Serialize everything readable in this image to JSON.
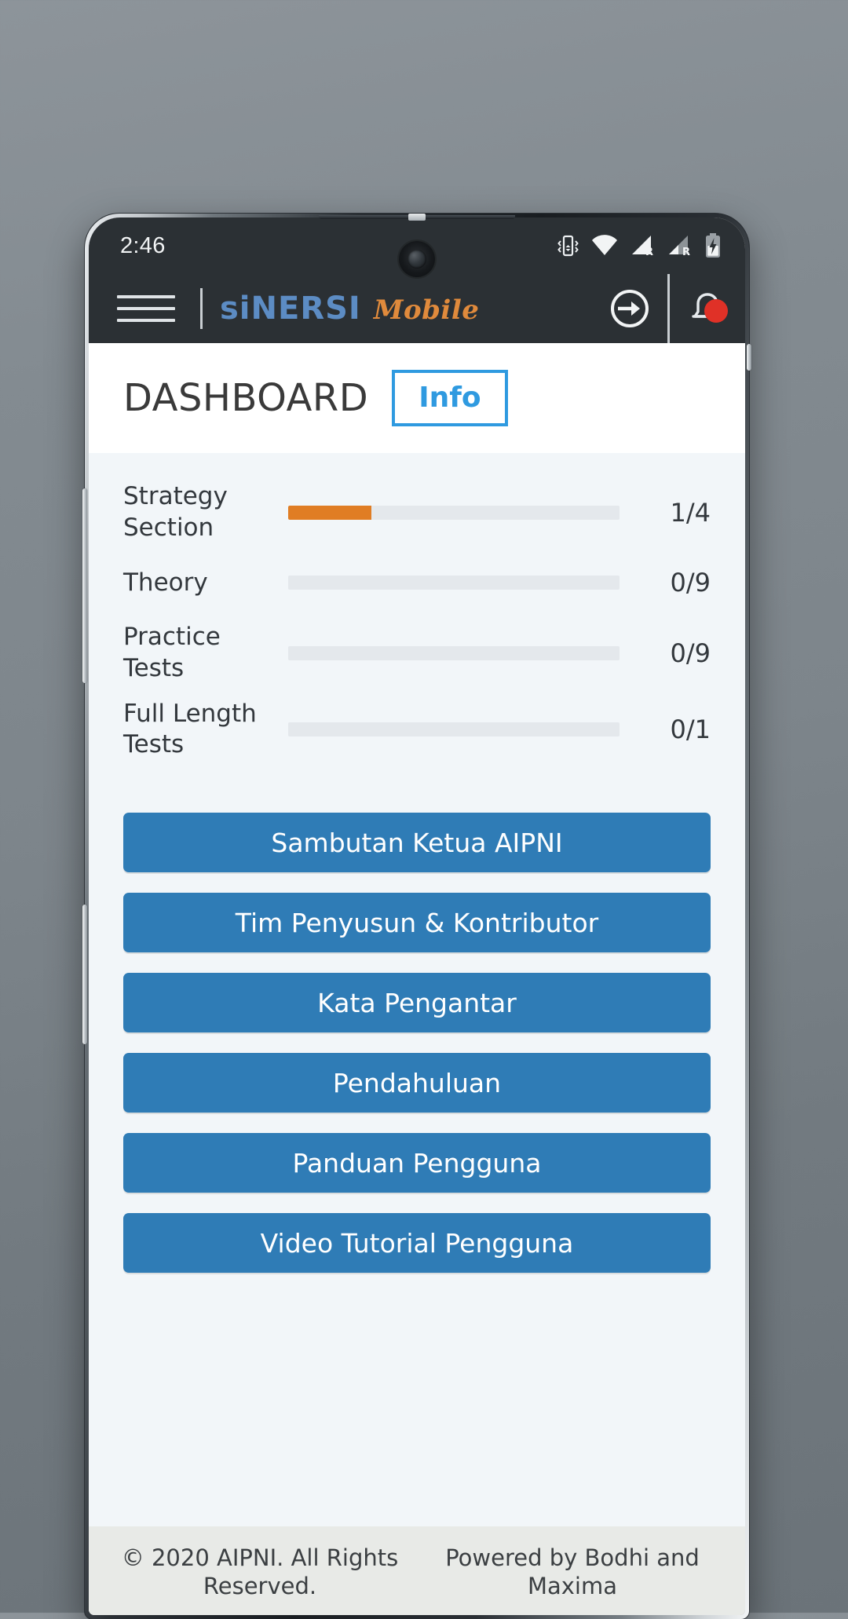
{
  "statusbar": {
    "clock": "2:46",
    "icons": [
      {
        "name": "vibrate-icon"
      },
      {
        "name": "wifi-icon"
      },
      {
        "name": "signal-roaming-icon-1",
        "label": "R"
      },
      {
        "name": "signal-roaming-icon-2",
        "label": "R"
      },
      {
        "name": "battery-charging-icon"
      }
    ]
  },
  "appbar": {
    "menu_icon": "hamburger-menu-icon",
    "brand_main": "siNERSI",
    "brand_sub": "Mobile",
    "logout_icon": "logout-icon",
    "notification_icon": "bell-icon",
    "notification_badge": ""
  },
  "titlebar": {
    "title": "DASHBOARD",
    "info_label": "Info"
  },
  "progress": {
    "rows": [
      {
        "label": "Strategy Section",
        "value": "1/4",
        "percent": 25
      },
      {
        "label": "Theory",
        "value": "0/9",
        "percent": 0
      },
      {
        "label": "Practice Tests",
        "value": "0/9",
        "percent": 0
      },
      {
        "label": "Full Length Tests",
        "value": "0/1",
        "percent": 0
      }
    ]
  },
  "buttons": [
    {
      "label": "Sambutan Ketua AIPNI"
    },
    {
      "label": "Tim Penyusun & Kontributor"
    },
    {
      "label": "Kata Pengantar"
    },
    {
      "label": "Pendahuluan"
    },
    {
      "label": "Panduan Pengguna"
    },
    {
      "label": "Video Tutorial Pengguna"
    }
  ],
  "footer": {
    "copyright": "© 2020 AIPNI. All Rights Reserved.",
    "powered_by": "Powered by Bodhi and Maxima"
  },
  "colors": {
    "appbar_bg": "#2b3034",
    "brand_blue": "#5c8cc4",
    "brand_orange": "#e08a3c",
    "accent_blue": "#2f9ae0",
    "button_blue": "#2f7cb6",
    "progress_orange": "#e07d24",
    "body_bg": "#f2f6f9",
    "footer_bg": "#e8eae7",
    "badge_red": "#e03127"
  }
}
